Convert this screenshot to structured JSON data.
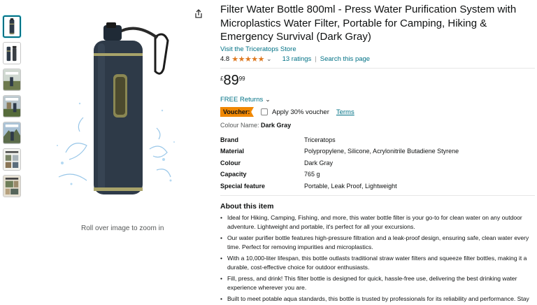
{
  "product": {
    "title": "Filter Water Bottle 800ml - Press Water Purification System with Microplastics Water Filter, Portable for Camping, Hiking & Emergency Survival (Dark Gray)",
    "store_link": "Visit the Triceratops Store",
    "rating_value": "4.8",
    "stars": "★★★★★",
    "rating_fraction": 0.96,
    "ratings_count": "13 ratings",
    "search_link": "Search this page",
    "price_currency": "£",
    "price_whole": "89",
    "price_fraction": "99",
    "returns": "FREE Returns",
    "voucher_badge": "Voucher:",
    "voucher_text": "Apply 30% voucher",
    "terms": "Terms",
    "colour_label": "Colour Name:",
    "colour_value": "Dark Gray"
  },
  "specs": [
    {
      "key": "Brand",
      "value": "Triceratops"
    },
    {
      "key": "Material",
      "value": "Polypropylene, Silicone, Acrylonitrile Butadiene Styrene"
    },
    {
      "key": "Colour",
      "value": "Dark Gray"
    },
    {
      "key": "Capacity",
      "value": "765 g"
    },
    {
      "key": "Special feature",
      "value": "Portable, Leak Proof, Lightweight"
    }
  ],
  "about": {
    "title": "About this item",
    "bullets": [
      "Ideal for Hiking, Camping, Fishing, and more, this water bottle filter is your go-to for clean water on any outdoor adventure. Lightweight and portable, it's perfect for all your excursions.",
      "Our water purifier bottle features high-pressure filtration and a leak-proof design, ensuring safe, clean water every time. Perfect for removing impurities and microplastics.",
      "With a 10,000-liter lifespan, this bottle outlasts traditional straw water filters and squeeze filter bottles, making it a durable, cost-effective choice for outdoor enthusiasts.",
      "Fill, press, and drink! This filter bottle is designed for quick, hassle-free use, delivering the best drinking water experience wherever you are.",
      "Built to meet potable aqua standards, this bottle is trusted by professionals for its reliability and performance. Stay hydrated safely on all your adventures."
    ]
  },
  "gallery": {
    "zoom_hint": "Roll over image to zoom in",
    "thumbnails": [
      "bottle-front",
      "bottle-parts",
      "outdoor-scene",
      "camping-scene",
      "mountain-scene",
      "features-grid",
      "usage-collage"
    ]
  },
  "icons": {
    "share": "share-icon",
    "chevron": "chevron-down-icon"
  },
  "colors": {
    "link": "#007185",
    "star": "#de7921",
    "voucher": "#f08804",
    "bottle": "#2e3a48",
    "accent": "#a8a36a"
  }
}
